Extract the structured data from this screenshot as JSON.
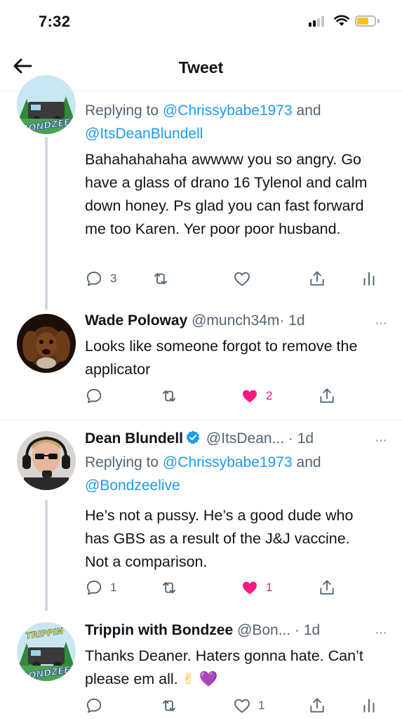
{
  "status_bar": {
    "time": "7:32"
  },
  "header": {
    "title": "Tweet"
  },
  "tweets": [
    {
      "reply_to_prefix": "Replying to",
      "mentions": [
        "@Chrissybabe1973",
        "@ItsDeanBlundell"
      ],
      "conjunction": "and",
      "text": "Bahahahahaha awwww you so angry. Go have a glass of drano 16 Tylenol and calm down honey. Ps glad you can fast forward me too Karen. Yer poor poor husband.",
      "stats": {
        "replies": "3",
        "likes": ""
      },
      "avatar_label": "BONDZEE"
    },
    {
      "name": "Wade Poloway",
      "handle": "@munch34m",
      "time": "· 1d",
      "text": "Looks like someone forgot to remove the applicator",
      "stats": {
        "likes": "2"
      },
      "liked": true
    },
    {
      "name": "Dean Blundell",
      "handle": "@ItsDean...",
      "time": "· 1d",
      "verified": true,
      "reply_to_prefix": "Replying to",
      "mentions": [
        "@Chrissybabe1973",
        "@Bondzeelive"
      ],
      "conjunction": "and",
      "text": "He’s not a pussy.  He’s a good dude who has GBS as a result of the J&J vaccine. Not a comparison.",
      "stats": {
        "replies": "1",
        "likes": "1"
      },
      "liked": true
    },
    {
      "name": "Trippin with Bondzee",
      "handle": "@Bon...",
      "time": "· 1d",
      "text": "Thanks Deaner. Haters gonna hate. Can’t please em all.",
      "emojis": [
        "✌",
        "💜"
      ],
      "stats": {
        "likes": "1"
      },
      "avatar_label_top": "TRIPPIN",
      "avatar_label": "BONDZEE"
    }
  ],
  "more_glyph": "···",
  "colors": {
    "accent": "#1d9bf0",
    "like": "#f91880",
    "muted": "#536471",
    "thread_line": "#cfd9de"
  },
  "icons": [
    "back-arrow-icon",
    "reply-icon",
    "retweet-icon",
    "like-icon",
    "share-icon",
    "analytics-icon",
    "more-icon",
    "verified-badge-icon"
  ]
}
